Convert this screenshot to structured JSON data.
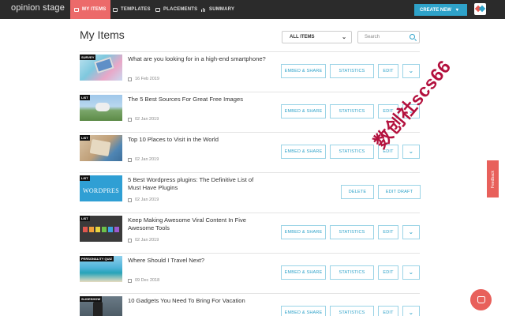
{
  "app": {
    "logo": "opinion stage"
  },
  "nav": {
    "items": [
      {
        "label": "MY ITEMS",
        "active": true
      },
      {
        "label": "TEMPLATES",
        "active": false
      },
      {
        "label": "PLACEMENTS",
        "active": false
      },
      {
        "label": "SUMMARY",
        "active": false
      }
    ],
    "create_label": "CREATE NEW",
    "create_caret": "▾"
  },
  "header": {
    "title": "My Items",
    "filter_value": "ALL ITEMS",
    "search_placeholder": "Search"
  },
  "items": [
    {
      "type": "SURVEY",
      "title": "What are you looking for in a high-end smartphone?",
      "date": "16 Feb 2019",
      "status": "published"
    },
    {
      "type": "LIST",
      "title": "The 5 Best Sources For Great Free Images",
      "date": "02 Jan 2019",
      "status": "published"
    },
    {
      "type": "LIST",
      "title": "Top 10 Places to Visit in the World",
      "date": "02 Jan 2019",
      "status": "published"
    },
    {
      "type": "LIST",
      "title": "5 Best Wordpress plugins: The Definitive List of Must Have Plugins",
      "date": "02 Jan 2019",
      "status": "draft",
      "thumb_text": "WORDPRES"
    },
    {
      "type": "LIST",
      "title": "Keep Making Awesome Viral Content In Five Awesome Tools",
      "date": "02 Jan 2019",
      "status": "published"
    },
    {
      "type": "PERSONALITY QUIZ",
      "title": "Where Should I Travel Next?",
      "date": "09 Dec 2018",
      "status": "published"
    },
    {
      "type": "SLIDESHOW",
      "title": "10 Gadgets You Need To Bring For Vacation",
      "date": "",
      "status": "published"
    }
  ],
  "buttons": {
    "embed": "EMBED & SHARE",
    "stats": "STATISTICS",
    "edit": "EDIT",
    "delete": "DELETE",
    "edit_draft": "EDIT DRAFT",
    "more": "⌄"
  },
  "overlay": {
    "watermark": "数创社scs66",
    "feedback": "Feedback"
  },
  "colors": {
    "nav_bg": "#2b2b2b",
    "nav_active": "#ec6a6a",
    "accent": "#2ea2c9",
    "feedback": "#e8605b",
    "watermark": "#b3103d"
  }
}
